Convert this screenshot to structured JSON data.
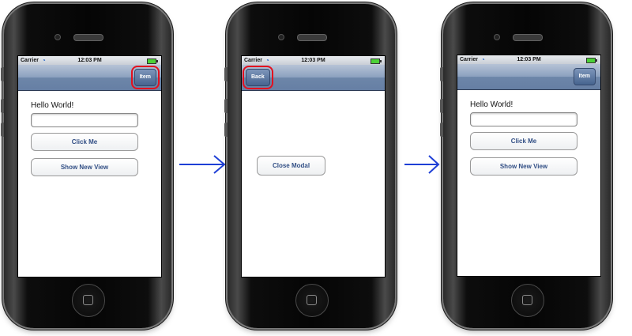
{
  "status_bar": {
    "carrier": "Carrier",
    "time": "12:03 PM"
  },
  "screens": [
    {
      "nav_button_label": "Item",
      "hello_label": "Hello World!",
      "text_field_value": "",
      "click_button_label": "Click Me",
      "show_view_button_label": "Show New View"
    },
    {
      "nav_button_label": "Back",
      "close_modal_label": "Close Modal"
    },
    {
      "nav_button_label": "Item",
      "hello_label": "Hello World!",
      "text_field_value": "",
      "click_button_label": "Click Me",
      "show_view_button_label": "Show New View"
    }
  ],
  "colors": {
    "highlight": "#e3101e",
    "arrow": "#1e3fd6",
    "navbar": "#6d86a9",
    "button_text": "#324f85"
  },
  "icons": [
    "wifi-icon",
    "battery-icon",
    "home-button-icon",
    "arrow-right-icon"
  ]
}
